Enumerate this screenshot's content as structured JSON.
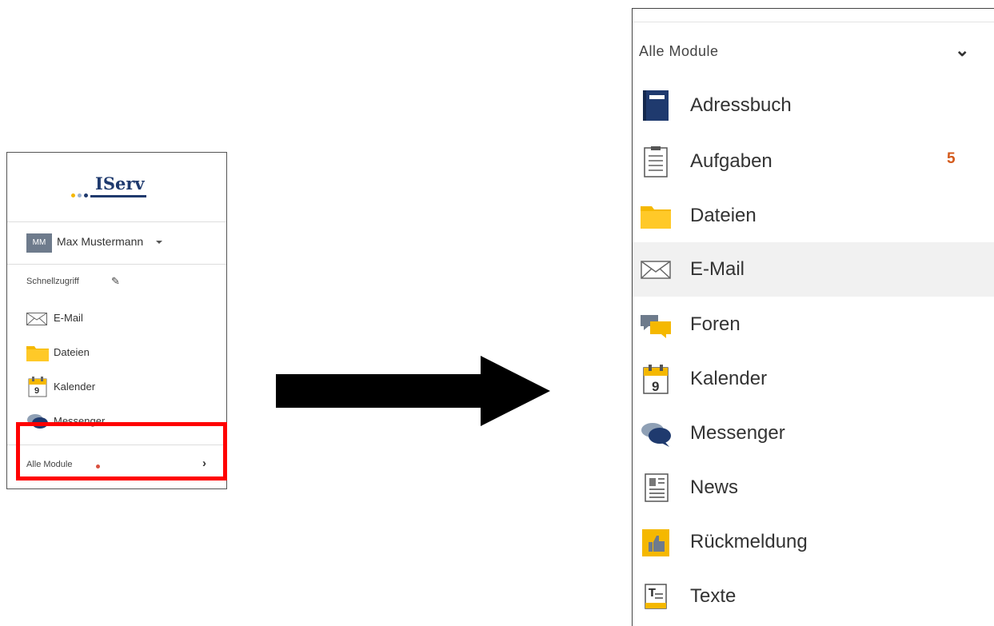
{
  "sidebar_small": {
    "logo_text": "IServ",
    "user": {
      "initials": "MM",
      "name": "Max Mustermann"
    },
    "quick_access_label": "Schnellzugriff",
    "items": [
      {
        "label": "E-Mail",
        "icon": "mail-icon"
      },
      {
        "label": "Dateien",
        "icon": "folder-icon"
      },
      {
        "label": "Kalender",
        "icon": "calendar-icon"
      },
      {
        "label": "Messenger",
        "icon": "messenger-icon"
      }
    ],
    "all_modules_label": "Alle Module",
    "calendar_day": "9"
  },
  "modules_panel": {
    "header_label": "Alle Module",
    "items": [
      {
        "label": "Adressbuch",
        "icon": "addressbook-icon"
      },
      {
        "label": "Aufgaben",
        "icon": "tasks-icon",
        "badge": "5"
      },
      {
        "label": "Dateien",
        "icon": "folder-icon"
      },
      {
        "label": "E-Mail",
        "icon": "mail-icon",
        "active": true
      },
      {
        "label": "Foren",
        "icon": "forum-icon"
      },
      {
        "label": "Kalender",
        "icon": "calendar-icon"
      },
      {
        "label": "Messenger",
        "icon": "messenger-icon"
      },
      {
        "label": "News",
        "icon": "news-icon"
      },
      {
        "label": "Rückmeldung",
        "icon": "feedback-icon"
      },
      {
        "label": "Texte",
        "icon": "texts-icon"
      }
    ],
    "calendar_day": "9"
  },
  "colors": {
    "brand_navy": "#1f3a6e",
    "folder_yellow": "#f5b800",
    "badge_orange": "#d45a1c",
    "highlight_red": "#ff0000"
  }
}
